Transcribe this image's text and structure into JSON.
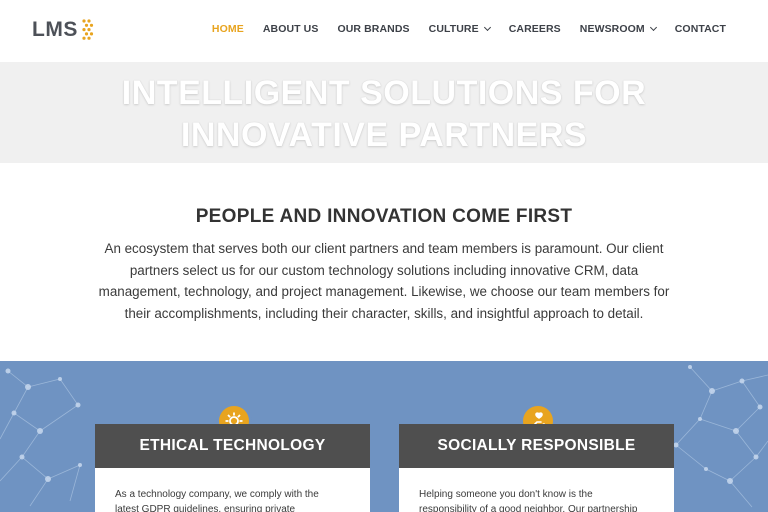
{
  "brand": {
    "logo_text": "LMS",
    "accent_color": "#e8a41f"
  },
  "nav": {
    "items": [
      {
        "label": "HOME",
        "active": true
      },
      {
        "label": "ABOUT US"
      },
      {
        "label": "OUR BRANDS"
      },
      {
        "label": "CULTURE",
        "dropdown": true
      },
      {
        "label": "CAREERS"
      },
      {
        "label": "NEWSROOM",
        "dropdown": true
      },
      {
        "label": "CONTACT"
      }
    ]
  },
  "hero": {
    "title_line1": "INTELLIGENT SOLUTIONS FOR",
    "title_line2": "INNOVATIVE PARTNERS"
  },
  "intro": {
    "heading": "PEOPLE AND INNOVATION COME FIRST",
    "lines": [
      "An ecosystem that serves both our client partners and team members is paramount. Our client",
      "partners select us for our custom technology solutions including innovative CRM, data",
      "management, technology, and project management. Likewise, we choose our team members for",
      "their accomplishments, including their character, skills, and insightful approach to detail."
    ]
  },
  "cards": [
    {
      "icon": "gear-icon",
      "title": "ETHICAL TECHNOLOGY",
      "lines": [
        "As a technology company, we comply with the",
        "latest GDPR guidelines, ensuring private"
      ]
    },
    {
      "icon": "helping-hand-icon",
      "title": "SOCIALLY RESPONSIBLE",
      "lines": [
        "Helping someone you don't know is the",
        "responsibility of a good neighbor. Our partnership"
      ]
    }
  ],
  "colors": {
    "band": "#6f93c2",
    "card_header": "#4f4f4f",
    "hero_bg": "#f0f0f0"
  }
}
